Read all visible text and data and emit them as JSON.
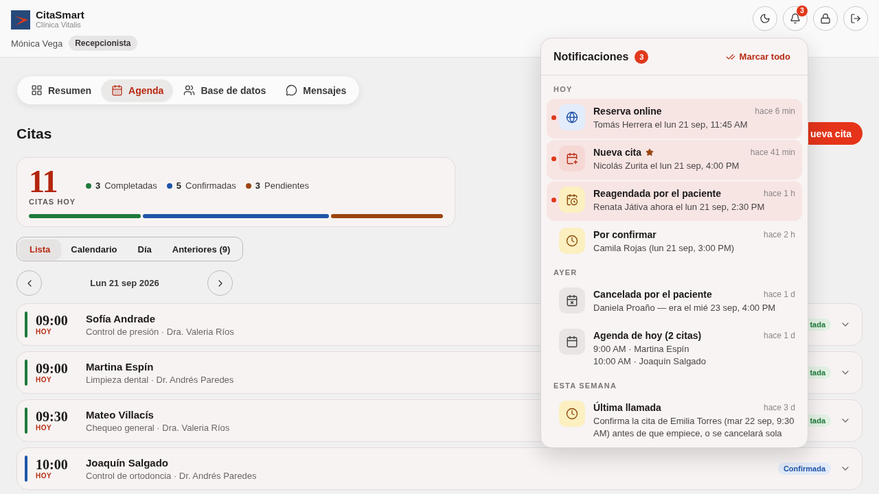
{
  "header": {
    "brand": {
      "name": "CitaSmart",
      "subtitle": "Clínica Vitalis"
    },
    "user": {
      "name": "Mónica Vega",
      "role": "Recepcionista"
    },
    "actions": [
      {
        "kind": "theme"
      },
      {
        "kind": "notifications",
        "badge": "3"
      },
      {
        "kind": "lock"
      },
      {
        "kind": "logout"
      }
    ]
  },
  "nav": [
    {
      "kind": "grid",
      "label": "Resumen",
      "selected": false
    },
    {
      "kind": "calendar",
      "label": "Agenda",
      "selected": true
    },
    {
      "kind": "users",
      "label": "Base de datos",
      "selected": false
    },
    {
      "kind": "chat",
      "label": "Mensajes",
      "selected": false
    }
  ],
  "page": {
    "title": "Citas",
    "new_button": "ueva cita"
  },
  "summary": {
    "total": "11",
    "caption": "CITAS HOY",
    "legend": [
      {
        "count": "3",
        "label": "Completadas",
        "color": "#1e7a3a"
      },
      {
        "count": "5",
        "label": "Confirmadas",
        "color": "#1f55a8"
      },
      {
        "count": "3",
        "label": "Pendientes",
        "color": "#9a4511"
      }
    ]
  },
  "view_tabs": [
    {
      "label": "Lista",
      "selected": true
    },
    {
      "label": "Calendario",
      "selected": false
    },
    {
      "label": "Día",
      "selected": false
    },
    {
      "label": "Anteriores (9)",
      "selected": false
    }
  ],
  "date_nav": {
    "date": "Lun 21 sep 2026"
  },
  "appointments": [
    {
      "time": "09:00",
      "day": "HOY",
      "patient": "Sofía Andrade",
      "detail": "Control de presión · Dra. Valeria Ríos",
      "status": {
        "kind": "completed",
        "label": "tada"
      }
    },
    {
      "time": "09:00",
      "day": "HOY",
      "patient": "Martina Espín",
      "detail": "Limpieza dental · Dr. Andrés Paredes",
      "status": {
        "kind": "completed",
        "label": "tada"
      }
    },
    {
      "time": "09:30",
      "day": "HOY",
      "patient": "Mateo Villacís",
      "detail": "Chequeo general · Dra. Valeria Ríos",
      "status": {
        "kind": "completed",
        "label": "tada"
      }
    },
    {
      "time": "10:00",
      "day": "HOY",
      "patient": "Joaquín Salgado",
      "detail": "Control de ortodoncia · Dr. Andrés Paredes",
      "status": {
        "kind": "confirmed",
        "label": "Confirmada"
      }
    }
  ],
  "notifications": {
    "title": "Notificaciones",
    "count": "3",
    "mark_all": "Marcar todo",
    "groups": [
      {
        "label": "HOY",
        "items": [
          {
            "kind": "globe",
            "title": "Reserva online",
            "time": "hace 6 min",
            "lines": [
              "Tomás Herrera el lun 21 sep, 11:45 AM"
            ],
            "unread": true,
            "starred": false
          },
          {
            "kind": "calendar-plus",
            "title": "Nueva cita",
            "time": "hace 41 min",
            "lines": [
              "Nicolás Zurita el lun 21 sep, 4:00 PM"
            ],
            "unread": true,
            "starred": true
          },
          {
            "kind": "calendar-clock",
            "title": "Reagendada por el paciente",
            "time": "hace 1 h",
            "lines": [
              "Renata Játiva ahora el lun 21 sep, 2:30 PM"
            ],
            "unread": true,
            "starred": false
          },
          {
            "kind": "clock",
            "title": "Por confirmar",
            "time": "hace 2 h",
            "lines": [
              "Camila Rojas (lun 21 sep, 3:00 PM)"
            ],
            "unread": false,
            "starred": false
          }
        ]
      },
      {
        "label": "AYER",
        "items": [
          {
            "kind": "calendar-x",
            "title": "Cancelada por el paciente",
            "time": "hace 1 d",
            "lines": [
              "Daniela Proaño — era el mié 23 sep, 4:00 PM"
            ],
            "unread": false,
            "starred": false
          },
          {
            "kind": "calendar",
            "title": "Agenda de hoy (2 citas)",
            "time": "hace 1 d",
            "lines": [
              "9:00 AM · Martina Espín",
              "10:00 AM · Joaquín Salgado"
            ],
            "unread": false,
            "starred": false
          }
        ]
      },
      {
        "label": "ESTA SEMANA",
        "items": [
          {
            "kind": "clock",
            "title": "Última llamada",
            "time": "hace 3 d",
            "lines": [
              "Confirma la cita de Emilia Torres (mar 22 sep, 9:30 AM) antes de que empiece, o se cancelará sola"
            ],
            "unread": false,
            "starred": false
          }
        ]
      }
    ]
  }
}
